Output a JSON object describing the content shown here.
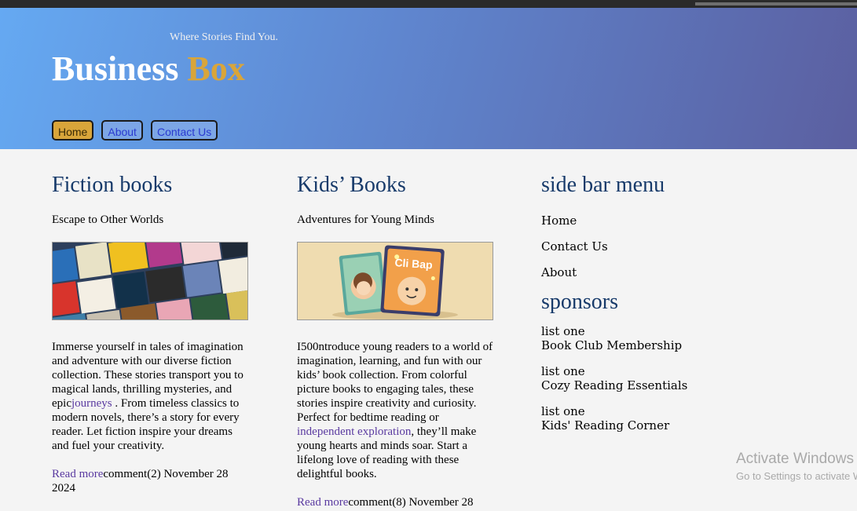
{
  "site": {
    "tagline": "Where Stories Find You.",
    "logo_word1": "Business",
    "logo_word2": "Box",
    "accent": "#d9a53a"
  },
  "nav": [
    "Home",
    "About",
    "Contact Us"
  ],
  "fiction": {
    "title": "Fiction books",
    "subtitle": "Escape to Other Worlds",
    "body_a": "Immerse yourself in tales of imagination and adventure with our diverse fiction collection. These stories transport you to magical lands, thrilling mysteries, and epic",
    "link": "journeys",
    "body_b": " . From timeless classics to modern novels, there’s a story for every reader. Let fiction inspire your dreams and fuel your creativity.",
    "read_more": "Read more",
    "meta": "comment(2) November 28 2024"
  },
  "kids": {
    "title": "Kids’ Books",
    "subtitle": "Adventures for Young Minds",
    "body_a": "I500ntroduce young readers to a world of imagination, learning, and fun with our kids’ book collection. From colorful picture books to engaging tales, these stories inspire creativity and curiosity. Perfect for bedtime reading or ",
    "link": "independent exploration",
    "body_b": ", they’ll make young hearts and minds soar. Start a lifelong love of reading with these delightful books.",
    "read_more": "Read more",
    "meta": "comment(8) November 28"
  },
  "sidebar": {
    "title": "side bar menu",
    "items": [
      "Home",
      "Contact Us",
      "About"
    ],
    "sponsors_title": "sponsors",
    "sponsors": [
      {
        "label": "list one",
        "name": "Book Club Membership"
      },
      {
        "label": "list one",
        "name": "Cozy Reading Essentials"
      },
      {
        "label": "list one",
        "name": "Kids' Reading Corner"
      }
    ]
  },
  "watermark": {
    "line1": "Activate Windows",
    "line2": "Go to Settings to activate Windows."
  }
}
